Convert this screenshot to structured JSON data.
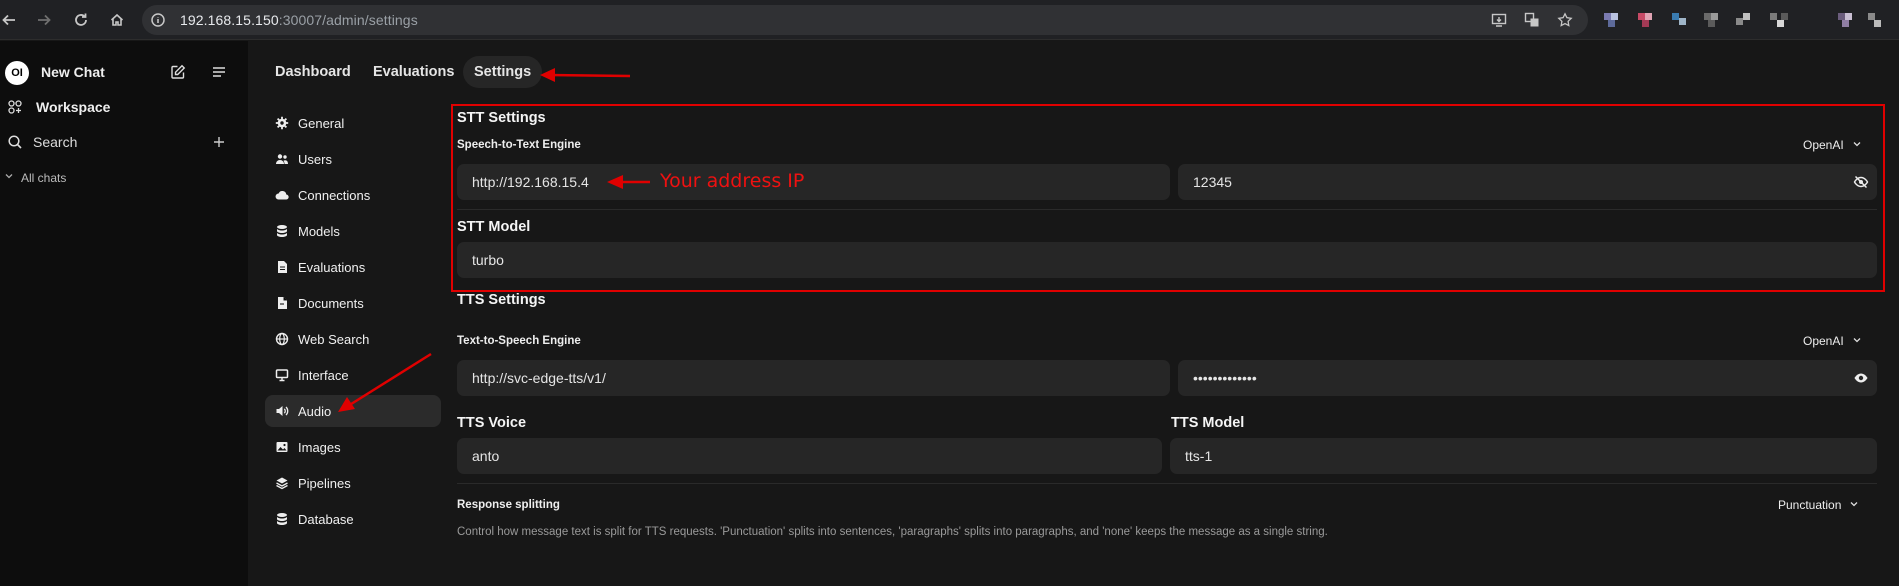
{
  "browser": {
    "url_host": "192.168.15.150",
    "url_rest": ":30007/admin/settings"
  },
  "sidebar": {
    "logo_text": "OI",
    "new_chat_label": "New Chat",
    "workspace_label": "Workspace",
    "search_label": "Search",
    "all_chats_label": "All chats"
  },
  "tabs": [
    {
      "label": "Dashboard"
    },
    {
      "label": "Evaluations"
    },
    {
      "label": "Settings"
    }
  ],
  "settings_nav": [
    {
      "label": "General",
      "icon": "gear-icon"
    },
    {
      "label": "Users",
      "icon": "users-icon"
    },
    {
      "label": "Connections",
      "icon": "cloud-icon"
    },
    {
      "label": "Models",
      "icon": "database-icon"
    },
    {
      "label": "Evaluations",
      "icon": "document-icon"
    },
    {
      "label": "Documents",
      "icon": "file-icon"
    },
    {
      "label": "Web Search",
      "icon": "globe-icon"
    },
    {
      "label": "Interface",
      "icon": "monitor-icon"
    },
    {
      "label": "Audio",
      "icon": "speaker-icon"
    },
    {
      "label": "Images",
      "icon": "image-icon"
    },
    {
      "label": "Pipelines",
      "icon": "pipelines-icon"
    },
    {
      "label": "Database",
      "icon": "database-icon"
    }
  ],
  "stt": {
    "heading": "STT Settings",
    "engine_label": "Speech-to-Text Engine",
    "engine_value": "OpenAI",
    "url_value": "http://192.168.15.4",
    "key_value": "12345",
    "model_heading": "STT Model",
    "model_value": "turbo"
  },
  "tts": {
    "heading": "TTS Settings",
    "engine_label": "Text-to-Speech Engine",
    "engine_value": "OpenAI",
    "url_value": "http://svc-edge-tts/v1/",
    "key_value": "•••••••••••••",
    "voice_label": "TTS Voice",
    "voice_value": "anto",
    "model_label": "TTS Model",
    "model_value": "tts-1"
  },
  "response_splitting": {
    "label": "Response splitting",
    "value": "Punctuation",
    "description": "Control how message text is split for TTS requests. 'Punctuation' splits into sentences, 'paragraphs' splits into paragraphs, and 'none' keeps the message as a single string."
  },
  "annotations": {
    "ip_note": "Your address IP"
  },
  "colors": {
    "annotation_red": "#e00000",
    "background": "#171717"
  }
}
